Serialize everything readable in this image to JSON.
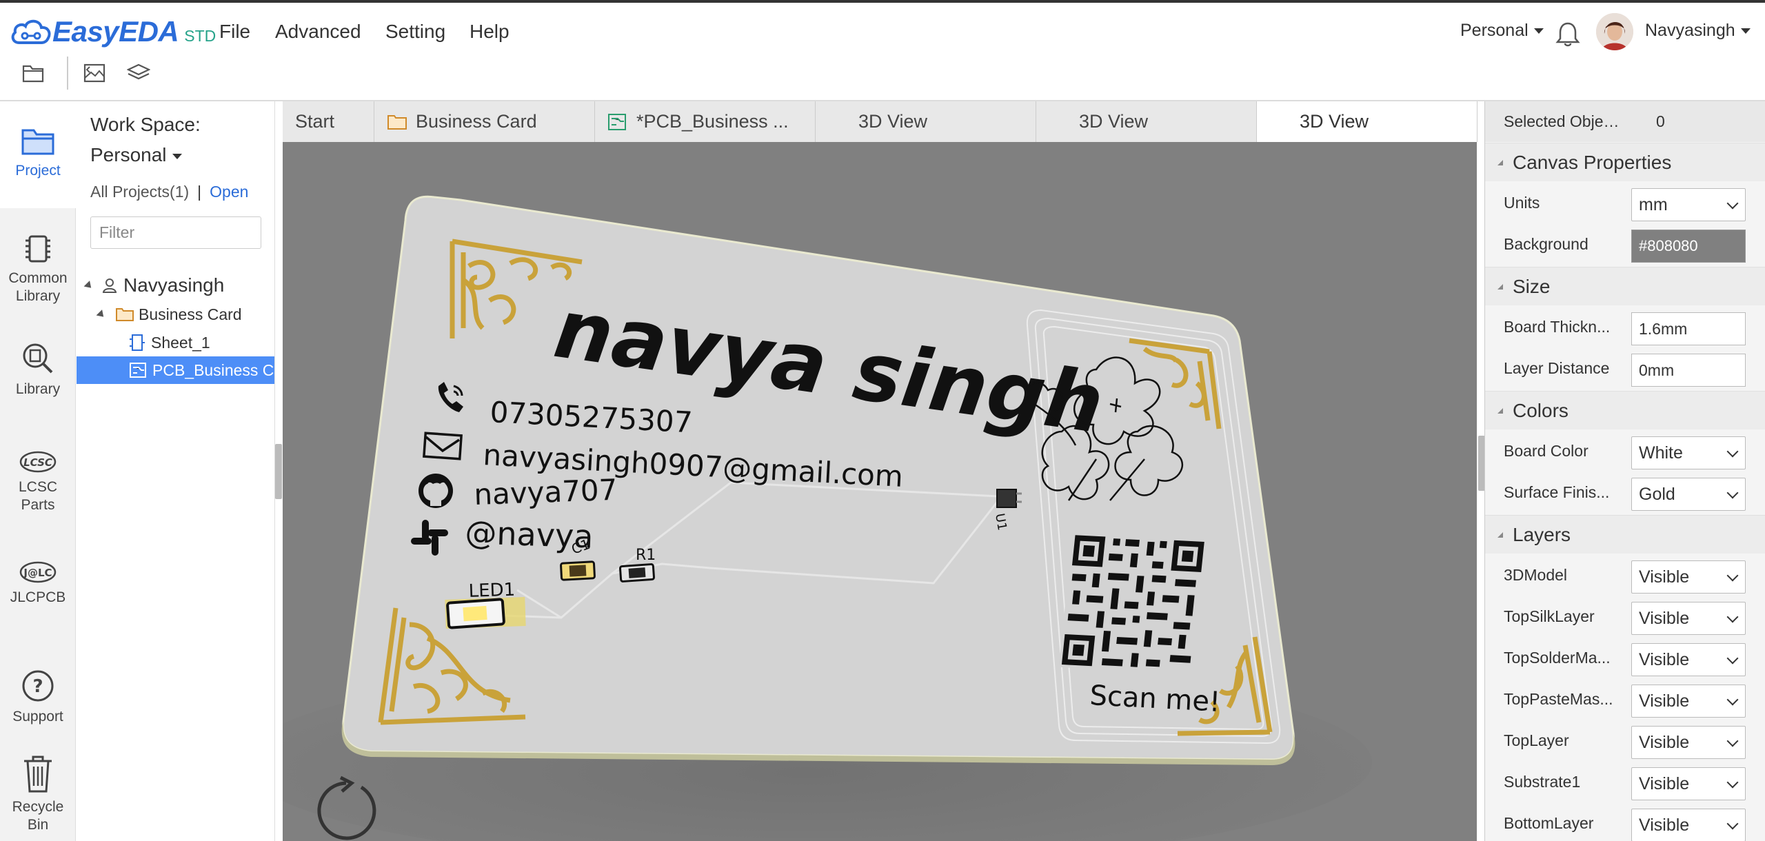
{
  "app": {
    "brand": "EasyEDA",
    "edition": "STD",
    "menu": [
      "File",
      "Advanced",
      "Setting",
      "Help"
    ],
    "team": "Personal",
    "username": "Navyasingh"
  },
  "toolbar": {
    "icons": [
      "folder-icon",
      "image-open-icon",
      "layers-icon"
    ]
  },
  "rail": [
    {
      "label": "Project",
      "icon": "project-folder-icon"
    },
    {
      "label": "Common Library",
      "icon": "chip-icon"
    },
    {
      "label": "Library",
      "icon": "library-search-icon"
    },
    {
      "label": "LCSC Parts",
      "icon": "lcsc-icon"
    },
    {
      "label": "JLCPCB",
      "icon": "jlc-icon"
    },
    {
      "label": "Support",
      "icon": "help-icon"
    },
    {
      "label": "Recycle Bin",
      "icon": "trash-icon"
    }
  ],
  "project_panel": {
    "workspace_label": "Work Space:",
    "workspace_value": "Personal",
    "all_projects": "All Projects(1)",
    "separator": "|",
    "open": "Open",
    "filter_placeholder": "Filter",
    "tree": {
      "user": "Navyasingh",
      "project": "Business Card",
      "sheet": "Sheet_1",
      "pcb": "PCB_Business C"
    }
  },
  "tabs": [
    {
      "label": "Start"
    },
    {
      "label": "Business Card"
    },
    {
      "label": "*PCB_Business ..."
    },
    {
      "label": "3D View"
    },
    {
      "label": "3D View"
    },
    {
      "label": "3D View"
    }
  ],
  "card": {
    "name": "navya singh",
    "phone": "07305275307",
    "email": "navyasingh0907@gmail.com",
    "github": "navya707",
    "slack": "@navya",
    "scan": "Scan me!",
    "led": "LED1",
    "r1": "R1",
    "c1": "C1",
    "u1": "U1"
  },
  "properties": {
    "selected_label": "Selected Objects",
    "selected_count": "0",
    "sections": {
      "canvas": "Canvas Properties",
      "size": "Size",
      "colors": "Colors",
      "layers": "Layers"
    },
    "units_label": "Units",
    "units_value": "mm",
    "background_label": "Background",
    "background_value": "#808080",
    "board_thickness_label": "Board Thickn...",
    "board_thickness_value": "1.6mm",
    "layer_distance_label": "Layer Distance",
    "layer_distance_value": "0mm",
    "board_color_label": "Board Color",
    "board_color_value": "White",
    "surface_finish_label": "Surface Finis...",
    "surface_finish_value": "Gold",
    "layers": [
      {
        "label": "3DModel",
        "value": "Visible"
      },
      {
        "label": "TopSilkLayer",
        "value": "Visible"
      },
      {
        "label": "TopSolderMa...",
        "value": "Visible"
      },
      {
        "label": "TopPasteMas...",
        "value": "Visible"
      },
      {
        "label": "TopLayer",
        "value": "Visible"
      },
      {
        "label": "Substrate1",
        "value": "Visible"
      },
      {
        "label": "BottomLayer",
        "value": "Visible"
      }
    ]
  },
  "colors": {
    "accent": "#2b6cd8",
    "canvas": "#808080",
    "gold": "#c9a23a",
    "board": "#d2d2d2",
    "selected": "#4d8ef7"
  }
}
